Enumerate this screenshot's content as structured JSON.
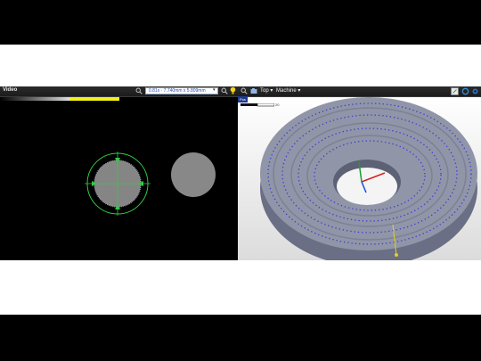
{
  "video": {
    "title": "Video",
    "measurement": "0.81x · 7.740mm x 5.809mm"
  },
  "model_view": {
    "view_label": "Top ▾",
    "machine_label": "Machine ▾",
    "position_badge": "Pos",
    "scale_label": "20"
  },
  "icons": [
    "search-icon",
    "zoom-icon",
    "light-bulb-icon",
    "zoom3d-icon",
    "camera-icon",
    "display-mode-icon",
    "sync-icon",
    "settings-icon"
  ],
  "colors": {
    "toolbar": "#222222",
    "crosshair": "#2ecc40",
    "part_fill": "#808080",
    "ring_top": "#9096a8",
    "holes": "#3a3ad0",
    "status_strip": "#f2f21a"
  }
}
